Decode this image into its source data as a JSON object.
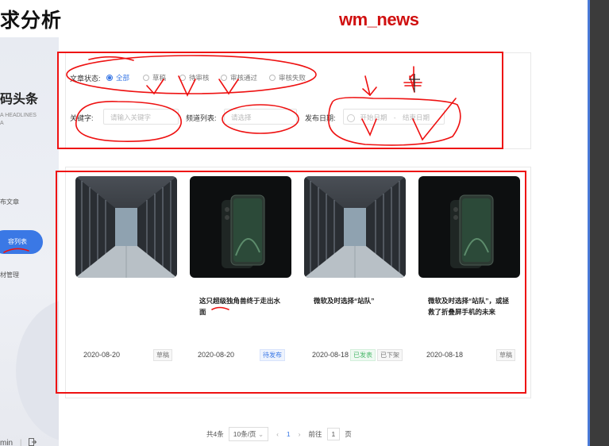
{
  "page": {
    "doc_title": "求分析",
    "header_label": "wm_news"
  },
  "sidebar": {
    "brand": "码头条",
    "brand_sub": "A HEADLINES",
    "brand_sub2": "A",
    "items": [
      {
        "label": "布文章"
      },
      {
        "label": "容列表"
      },
      {
        "label": "材管理"
      }
    ],
    "user_label": "min",
    "logout_icon": "logout-icon"
  },
  "filters": {
    "status_label": "文章状态:",
    "status_options": [
      {
        "label": "全部",
        "selected": true
      },
      {
        "label": "草稿",
        "selected": false
      },
      {
        "label": "待审核",
        "selected": false
      },
      {
        "label": "审核通过",
        "selected": false
      },
      {
        "label": "审核失败",
        "selected": false
      }
    ],
    "keyword_label": "关键字:",
    "keyword_placeholder": "请输入关键字",
    "channel_label": "频道列表:",
    "channel_placeholder": "请选择",
    "date_label": "发布日期:",
    "date_start_placeholder": "开始日期",
    "date_sep": "-",
    "date_end_placeholder": "结束日期"
  },
  "articles": [
    {
      "title": "",
      "date": "2020-08-20",
      "badges": [
        {
          "text": "草稿",
          "color": "gray"
        }
      ],
      "image": "server-room"
    },
    {
      "title": "这只超级独角兽终于走出水面",
      "date": "2020-08-20",
      "badges": [
        {
          "text": "待发布",
          "color": "blue"
        }
      ],
      "image": "phone"
    },
    {
      "title": "微软及时选择“站队”",
      "date": "2020-08-18",
      "badges": [
        {
          "text": "已发表",
          "color": "green"
        },
        {
          "text": "已下架",
          "color": "gray"
        }
      ],
      "image": "server-room"
    },
    {
      "title": "微软及时选择“站队”，或拯救了折叠屏手机的未来",
      "date": "2020-08-18",
      "badges": [
        {
          "text": "草稿",
          "color": "gray"
        }
      ],
      "image": "phone"
    }
  ],
  "pagination": {
    "total": "共4条",
    "page_size": "10条/页",
    "prev": "‹",
    "current": "1",
    "next": "›",
    "goto_label": "前往",
    "goto_value": "1",
    "page_suffix": "页"
  },
  "colors": {
    "accent": "#3a78e5",
    "annotation": "#e11111",
    "status_green": "#4bb76b"
  }
}
